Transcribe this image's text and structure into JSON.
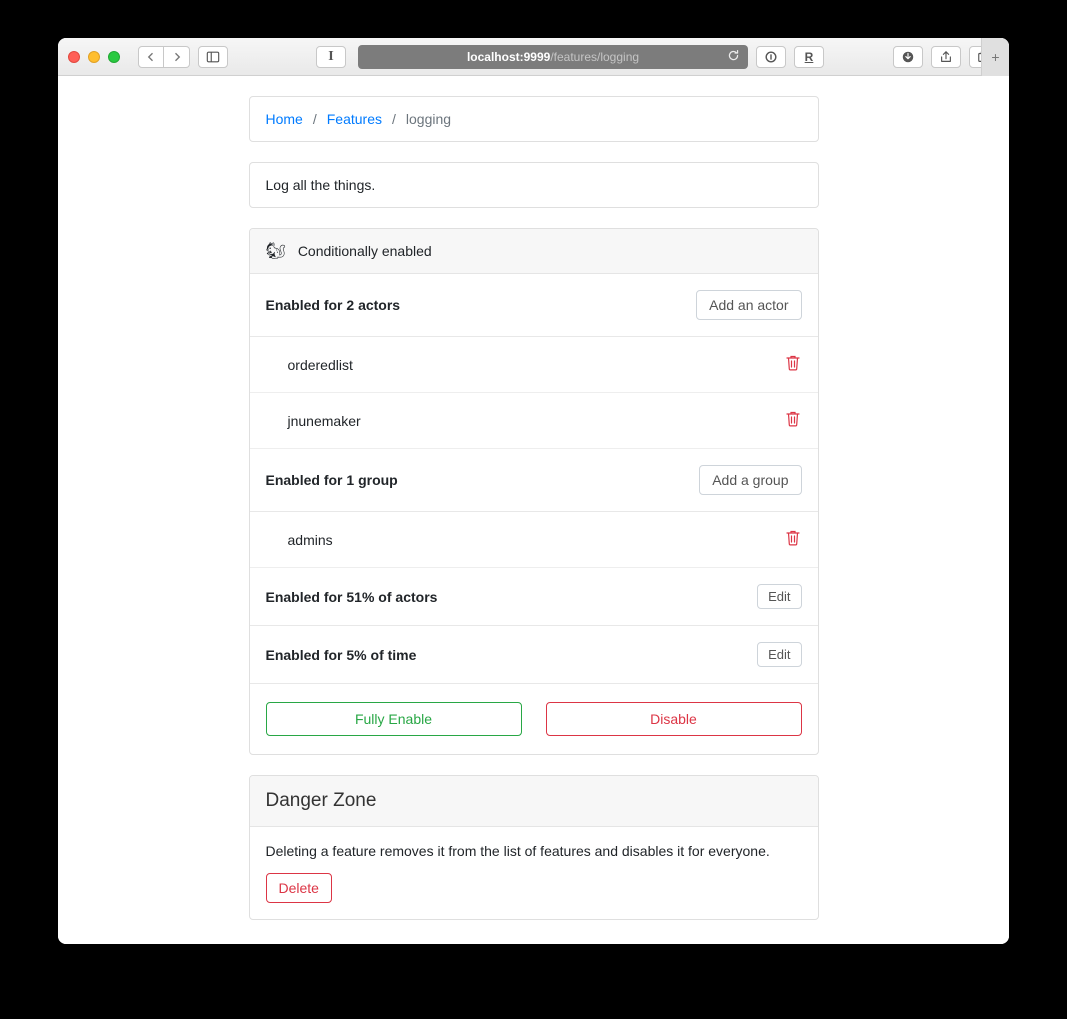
{
  "browser": {
    "host": "localhost:9999",
    "path": "/features/logging"
  },
  "breadcrumb": {
    "home": "Home",
    "features": "Features",
    "current": "logging"
  },
  "description": "Log all the things.",
  "status": {
    "emoji": "🐿",
    "label": "Conditionally enabled"
  },
  "actors": {
    "title": "Enabled for 2 actors",
    "add_label": "Add an actor",
    "items": [
      "orderedlist",
      "jnunemaker"
    ]
  },
  "groups": {
    "title": "Enabled for 1 group",
    "add_label": "Add a group",
    "items": [
      "admins"
    ]
  },
  "percent_actors": {
    "title": "Enabled for 51% of actors",
    "edit_label": "Edit"
  },
  "percent_time": {
    "title": "Enabled for 5% of time",
    "edit_label": "Edit"
  },
  "actions": {
    "fully_enable": "Fully Enable",
    "disable": "Disable"
  },
  "danger": {
    "title": "Danger Zone",
    "text": "Deleting a feature removes it from the list of features and disables it for everyone.",
    "delete_label": "Delete"
  }
}
